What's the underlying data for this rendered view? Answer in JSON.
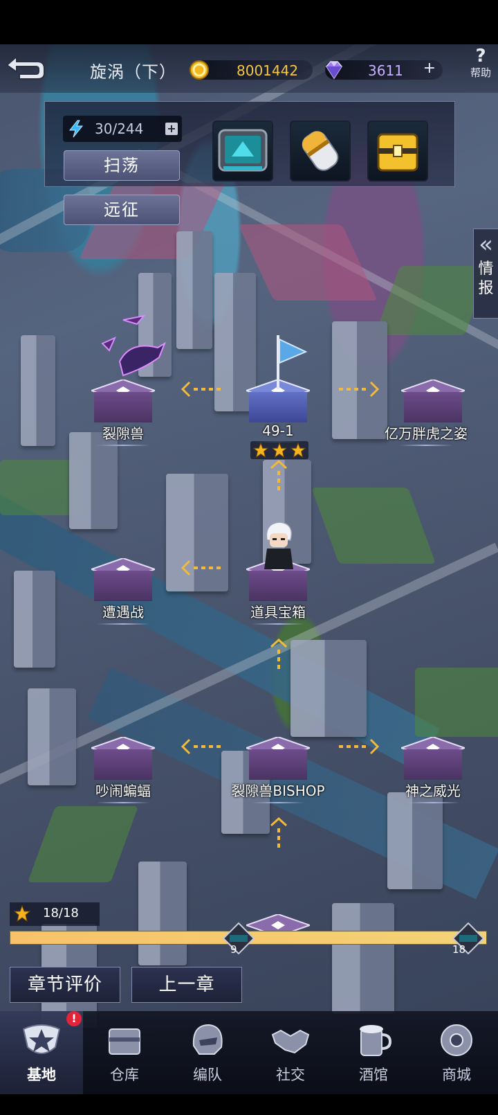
{
  "header": {
    "title": "旋涡（下）",
    "coins": "8001442",
    "gems": "3611",
    "gem_add_label": "+",
    "help_label": "帮助"
  },
  "panel": {
    "energy": "30/244",
    "energy_add_label": "+",
    "sweep_label": "扫荡",
    "expedition_label": "远征",
    "rewards": [
      "map-chip-reward-icon",
      "capsule-reward-icon",
      "gold-crate-reward-icon"
    ]
  },
  "intel_tab": {
    "label": "情报"
  },
  "map": {
    "nodes": [
      {
        "label": "裂隙兽"
      },
      {
        "label": "49-1",
        "stars": 3
      },
      {
        "label": "亿万胖虎之姿"
      },
      {
        "label": "遭遇战"
      },
      {
        "label": "道具宝箱"
      },
      {
        "label": "吵闹蝙蝠"
      },
      {
        "label": "裂隙兽BISHOP"
      },
      {
        "label": "神之威光"
      }
    ]
  },
  "progress": {
    "count": "18/18",
    "stars_earned": 18,
    "stars_total": 18,
    "milestones": [
      {
        "stars": "9"
      },
      {
        "stars": "18"
      }
    ]
  },
  "buttons": {
    "chapter_rating": "章节评价",
    "previous_chapter": "上一章"
  },
  "nav": {
    "items": [
      {
        "label": "基地",
        "icon": "base-emblem-icon",
        "active": true,
        "alert": "!"
      },
      {
        "label": "仓库",
        "icon": "warehouse-icon"
      },
      {
        "label": "编队",
        "icon": "formation-helmet-icon"
      },
      {
        "label": "社交",
        "icon": "handshake-icon"
      },
      {
        "label": "酒馆",
        "icon": "tavern-mug-icon"
      },
      {
        "label": "商城",
        "icon": "shop-robot-icon"
      }
    ]
  },
  "colors": {
    "coin": "#f6c645",
    "gem": "#c8b2ff",
    "progress": "#f3d277",
    "node_purple": "#6d4c8a",
    "node_blue": "#6271c6",
    "alert": "#e0253a"
  }
}
